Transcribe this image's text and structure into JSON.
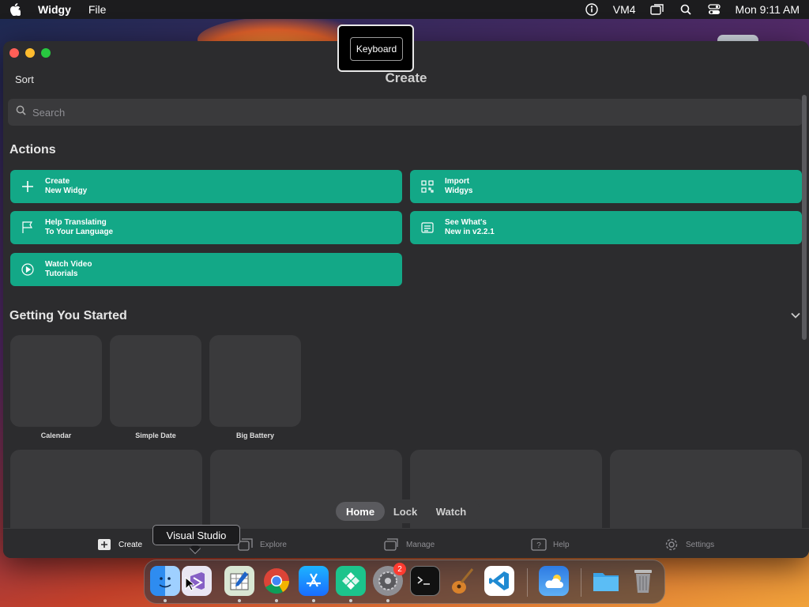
{
  "menubar": {
    "app_name": "Widgy",
    "menus": [
      "File"
    ],
    "user": "VM4",
    "clock": "Mon 9:11 AM",
    "icons": [
      "apple-icon",
      "accessibility-icon",
      "window-icon",
      "spotlight-icon",
      "control-center-icon"
    ]
  },
  "keyboard_popup": {
    "label": "Keyboard"
  },
  "window": {
    "sort_label": "Sort",
    "title": "Create",
    "search_placeholder": "Search"
  },
  "actions": {
    "title": "Actions",
    "items": [
      {
        "line1": "Create",
        "line2": "New Widgy",
        "icon": "plus-icon"
      },
      {
        "line1": "Import",
        "line2": "Widgys",
        "icon": "qr-code-icon"
      },
      {
        "line1": "Help Translating",
        "line2": "To Your Language",
        "icon": "flag-icon"
      },
      {
        "line1": "See What's",
        "line2": "New in v2.2.1",
        "icon": "news-icon"
      },
      {
        "line1": "Watch Video",
        "line2": "Tutorials",
        "icon": "play-circle-icon"
      }
    ]
  },
  "getting_started": {
    "title": "Getting You Started",
    "tiles": [
      "Calendar",
      "Simple Date",
      "Big Battery"
    ]
  },
  "segment": {
    "options": [
      "Home",
      "Lock",
      "Watch"
    ],
    "selected": "Home"
  },
  "tabbar": {
    "tabs": [
      {
        "label": "Create",
        "icon": "plus-square-icon",
        "active": true
      },
      {
        "label": "Explore",
        "icon": "explore-icon",
        "active": false
      },
      {
        "label": "Manage",
        "icon": "manage-icon",
        "active": false
      },
      {
        "label": "Help",
        "icon": "help-icon",
        "active": false
      },
      {
        "label": "Settings",
        "icon": "gear-icon",
        "active": false
      }
    ]
  },
  "dock": {
    "tooltip": "Visual Studio",
    "settings_badge": "2",
    "apps": [
      "Finder",
      "Visual Studio",
      "Numbers",
      "Chrome",
      "App Store",
      "Widgy",
      "System Settings",
      "Terminal",
      "GarageBand",
      "VS Code",
      "Weather",
      "Folder",
      "Trash"
    ]
  },
  "colors": {
    "accent": "#13a887",
    "window_bg": "#2c2c2e",
    "tile_bg": "#3a3a3c"
  }
}
